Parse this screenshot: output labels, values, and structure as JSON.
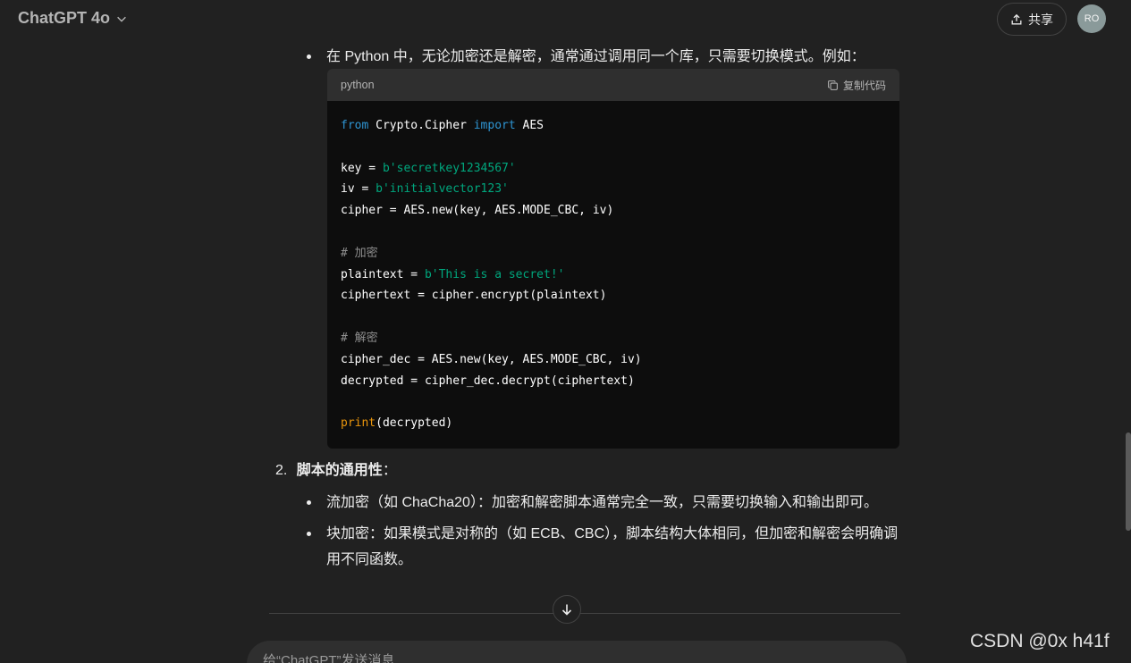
{
  "header": {
    "model_name": "ChatGPT 4o",
    "share_label": "共享",
    "avatar_initials": "RO"
  },
  "message": {
    "bullet_python_intro": "在 Python 中，无论加密还是解密，通常通过调用同一个库，只需要切换模式。例如：",
    "code_block": {
      "language": "python",
      "copy_label": "复制代码",
      "lines": [
        "from Crypto.Cipher import AES",
        "",
        "key = b'secretkey1234567'",
        "iv = b'initialvector123'",
        "cipher = AES.new(key, AES.MODE_CBC, iv)",
        "",
        "# 加密",
        "plaintext = b'This is a secret!'",
        "ciphertext = cipher.encrypt(plaintext)",
        "",
        "# 解密",
        "cipher_dec = AES.new(key, AES.MODE_CBC, iv)",
        "decrypted = cipher_dec.decrypt(ciphertext)",
        "",
        "print(decrypted)"
      ]
    },
    "item2_number": "2.",
    "item2_title": "脚本的通用性",
    "item2_colon": "：",
    "bullet_stream": "流加密（如 ChaCha20）：加密和解密脚本通常完全一致，只需要切换输入和输出即可。",
    "bullet_block_line1": "块加密：如果模式是对称的（如 ECB、CBC），脚本结构大体相同，但加密和解密会明确调",
    "bullet_block_line2": "用不同函数。"
  },
  "composer": {
    "placeholder": "给“ChatGPT”发送消息"
  },
  "watermark": "CSDN @0x h41f",
  "colors": {
    "background": "#212121",
    "code_bg": "#0d0d0d",
    "code_header_bg": "#2f2f2f",
    "keyword": "#2e95d3",
    "string": "#00a67d",
    "comment": "#8f8f8f",
    "function": "#e9950c"
  },
  "icons": {
    "model_dropdown": "chevron-down-icon",
    "share": "share-upload-icon",
    "copy": "copy-icon",
    "scroll_down": "arrow-down-icon"
  }
}
